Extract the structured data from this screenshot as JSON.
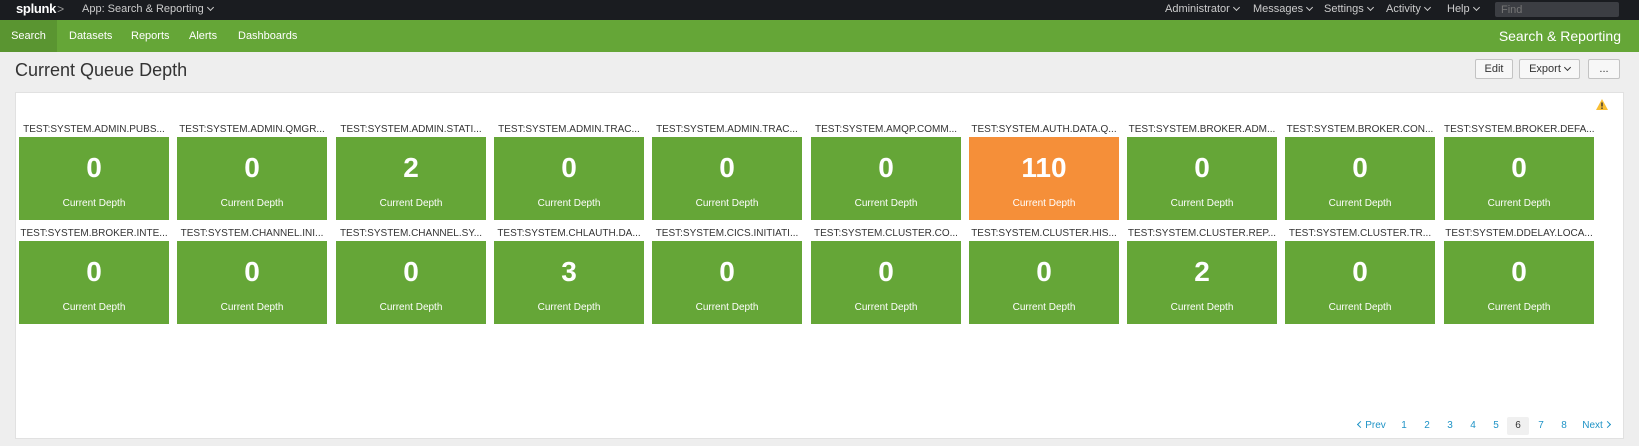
{
  "topbar": {
    "logo": "splunk",
    "logo_suffix": ">",
    "app_selector": "App: Search & Reporting",
    "menus": [
      "Administrator",
      "Messages",
      "Settings",
      "Activity",
      "Help"
    ],
    "find_placeholder": "Find"
  },
  "nav": {
    "items": [
      "Search",
      "Datasets",
      "Reports",
      "Alerts",
      "Dashboards"
    ],
    "active": "Search",
    "app_title": "Search & Reporting"
  },
  "page": {
    "title": "Current Queue Depth",
    "edit_label": "Edit",
    "export_label": "Export",
    "more_label": "..."
  },
  "colors": {
    "ok": "#65a637",
    "warning": "#f58f39",
    "alert_icon": "#f8be34"
  },
  "tiles": [
    {
      "title": "TEST:SYSTEM.ADMIN.PUBS...",
      "value": "0",
      "label": "Current Depth",
      "status": "ok"
    },
    {
      "title": "TEST:SYSTEM.ADMIN.QMGR...",
      "value": "0",
      "label": "Current Depth",
      "status": "ok"
    },
    {
      "title": "TEST:SYSTEM.ADMIN.STATI...",
      "value": "2",
      "label": "Current Depth",
      "status": "ok"
    },
    {
      "title": "TEST:SYSTEM.ADMIN.TRAC...",
      "value": "0",
      "label": "Current Depth",
      "status": "ok"
    },
    {
      "title": "TEST:SYSTEM.ADMIN.TRAC...",
      "value": "0",
      "label": "Current Depth",
      "status": "ok"
    },
    {
      "title": "TEST:SYSTEM.AMQP.COMM...",
      "value": "0",
      "label": "Current Depth",
      "status": "ok"
    },
    {
      "title": "TEST:SYSTEM.AUTH.DATA.Q...",
      "value": "110",
      "label": "Current Depth",
      "status": "warning"
    },
    {
      "title": "TEST:SYSTEM.BROKER.ADM...",
      "value": "0",
      "label": "Current Depth",
      "status": "ok"
    },
    {
      "title": "TEST:SYSTEM.BROKER.CON...",
      "value": "0",
      "label": "Current Depth",
      "status": "ok"
    },
    {
      "title": "TEST:SYSTEM.BROKER.DEFA...",
      "value": "0",
      "label": "Current Depth",
      "status": "ok"
    },
    {
      "title": "TEST:SYSTEM.BROKER.INTE...",
      "value": "0",
      "label": "Current Depth",
      "status": "ok"
    },
    {
      "title": "TEST:SYSTEM.CHANNEL.INI...",
      "value": "0",
      "label": "Current Depth",
      "status": "ok"
    },
    {
      "title": "TEST:SYSTEM.CHANNEL.SY...",
      "value": "0",
      "label": "Current Depth",
      "status": "ok"
    },
    {
      "title": "TEST:SYSTEM.CHLAUTH.DA...",
      "value": "3",
      "label": "Current Depth",
      "status": "ok"
    },
    {
      "title": "TEST:SYSTEM.CICS.INITIATI...",
      "value": "0",
      "label": "Current Depth",
      "status": "ok"
    },
    {
      "title": "TEST:SYSTEM.CLUSTER.CO...",
      "value": "0",
      "label": "Current Depth",
      "status": "ok"
    },
    {
      "title": "TEST:SYSTEM.CLUSTER.HIS...",
      "value": "0",
      "label": "Current Depth",
      "status": "ok"
    },
    {
      "title": "TEST:SYSTEM.CLUSTER.REP...",
      "value": "2",
      "label": "Current Depth",
      "status": "ok"
    },
    {
      "title": "TEST:SYSTEM.CLUSTER.TR...",
      "value": "0",
      "label": "Current Depth",
      "status": "ok"
    },
    {
      "title": "TEST:SYSTEM.DDELAY.LOCA...",
      "value": "0",
      "label": "Current Depth",
      "status": "ok"
    }
  ],
  "pagination": {
    "prev": "Prev",
    "next": "Next",
    "pages": [
      "1",
      "2",
      "3",
      "4",
      "5",
      "6",
      "7",
      "8"
    ],
    "current": "6"
  }
}
